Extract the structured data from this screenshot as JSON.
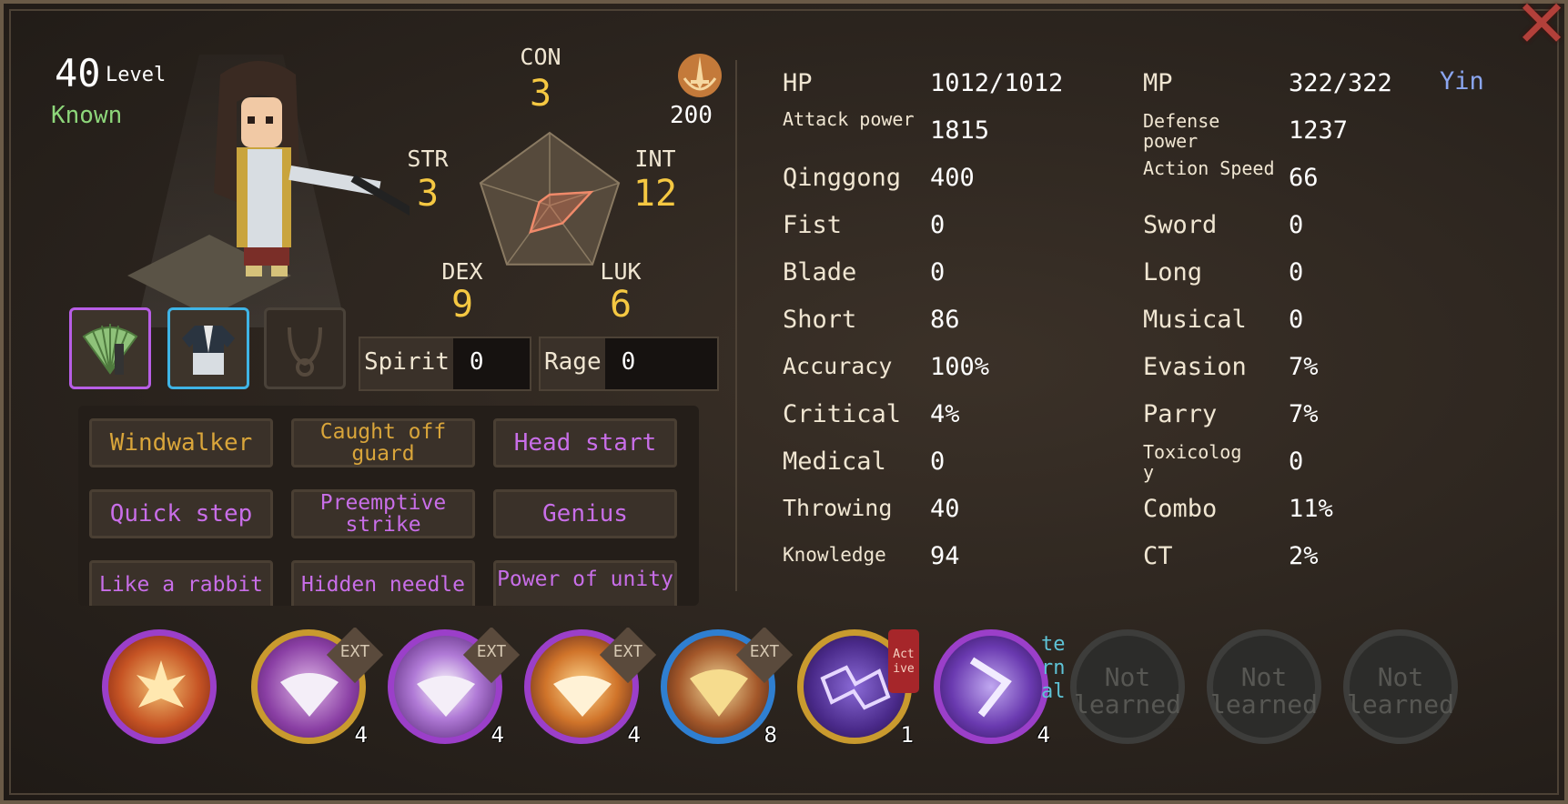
{
  "character": {
    "level": "40",
    "level_label": "Level",
    "status": "Known",
    "emblem_value": "200",
    "alignment": "Yin"
  },
  "attributes": [
    {
      "name": "CON",
      "value": "3"
    },
    {
      "name": "STR",
      "value": "3"
    },
    {
      "name": "INT",
      "value": "12"
    },
    {
      "name": "DEX",
      "value": "9"
    },
    {
      "name": "LUK",
      "value": "6"
    }
  ],
  "resources": {
    "spirit_label": "Spirit",
    "spirit_value": "0",
    "rage_label": "Rage",
    "rage_value": "0"
  },
  "equipment": [
    {
      "slot": "weapon",
      "icon": "fan-icon",
      "rarity_color": "#b85ee6"
    },
    {
      "slot": "armor",
      "icon": "robe-icon",
      "rarity_color": "#3fb4e6"
    },
    {
      "slot": "accessory",
      "icon": "necklace-icon",
      "empty": true
    }
  ],
  "traits": [
    {
      "label": "Windwalker",
      "color": "gold"
    },
    {
      "label": "Caught off guard",
      "color": "gold"
    },
    {
      "label": "Head start",
      "color": "purple"
    },
    {
      "label": "Quick step",
      "color": "purple"
    },
    {
      "label": "Preemptive strike",
      "color": "purple"
    },
    {
      "label": "Genius",
      "color": "purple"
    },
    {
      "label": "Like a rabbit",
      "color": "purple"
    },
    {
      "label": "Hidden needle",
      "color": "purple"
    },
    {
      "label": "Power of unity",
      "color": "purple"
    }
  ],
  "stats_left": [
    {
      "label": "HP",
      "value": "1012/1012"
    },
    {
      "label": "Attack power",
      "value": "1815"
    },
    {
      "label": "Qinggong",
      "value": "400"
    },
    {
      "label": "Fist",
      "value": "0"
    },
    {
      "label": "Blade",
      "value": "0"
    },
    {
      "label": "Short",
      "value": "86"
    },
    {
      "label": "Accuracy",
      "value": "100%"
    },
    {
      "label": "Critical",
      "value": "4%"
    },
    {
      "label": "Medical",
      "value": "0"
    },
    {
      "label": "Throwing",
      "value": "40"
    },
    {
      "label": "Knowledge",
      "value": "94"
    }
  ],
  "stats_right": [
    {
      "label": "MP",
      "value": "322/322"
    },
    {
      "label": "Defense power",
      "value": "1237"
    },
    {
      "label": "Action Speed",
      "value": "66"
    },
    {
      "label": "Sword",
      "value": "0"
    },
    {
      "label": "Long",
      "value": "0"
    },
    {
      "label": "Musical",
      "value": "0"
    },
    {
      "label": "Evasion",
      "value": "7%"
    },
    {
      "label": "Parry",
      "value": "7%"
    },
    {
      "label": "Toxicology",
      "value": "0"
    },
    {
      "label": "Combo",
      "value": "11%"
    },
    {
      "label": "CT",
      "value": "2%"
    }
  ],
  "skills": [
    {
      "icon": "flame-burst-icon",
      "ring": "#9b3fc9"
    },
    {
      "icon": "fan-sparkle-icon",
      "ring": "#c99a2e",
      "tag": "EXT",
      "count": "4"
    },
    {
      "icon": "fan-light-icon",
      "ring": "#9b3fc9",
      "tag": "EXT",
      "count": "4"
    },
    {
      "icon": "fan-fire-icon",
      "ring": "#9b3fc9",
      "tag": "EXT",
      "count": "4"
    },
    {
      "icon": "fan-gold-icon",
      "ring": "#2f7fd1",
      "tag": "EXT",
      "count": "8"
    },
    {
      "icon": "lightning-icon",
      "ring": "#c99a2e",
      "tag": "Act ive",
      "count": "1"
    },
    {
      "icon": "dash-icon",
      "ring": "#9b3fc9",
      "tag": "In te rn al",
      "count": "4"
    },
    {
      "label": "Not learned"
    },
    {
      "label": "Not learned"
    },
    {
      "label": "Not learned"
    }
  ],
  "colors": {
    "attribute_value": "#f5c842",
    "known_status": "#8dd67a",
    "trait_gold": "#d9a53a",
    "trait_purple": "#c86ee8",
    "alignment": "#8ba6f0"
  }
}
